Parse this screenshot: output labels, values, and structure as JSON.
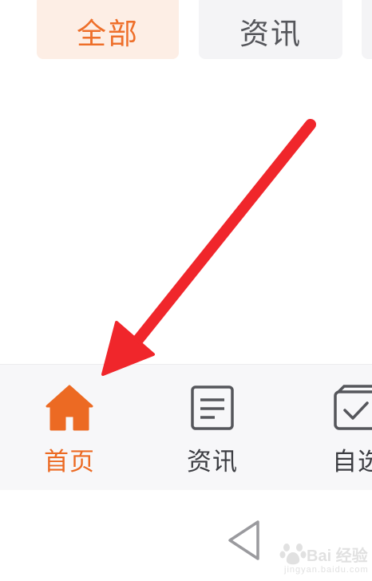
{
  "filter_tabs": {
    "items": [
      {
        "label": "全部",
        "state": "active"
      },
      {
        "label": "资讯",
        "state": "normal"
      }
    ]
  },
  "bottom_nav": {
    "items": [
      {
        "label": "首页",
        "icon": "home-icon",
        "state": "active"
      },
      {
        "label": "资讯",
        "icon": "document-icon",
        "state": "normal"
      },
      {
        "label": "自选",
        "icon": "checkbox-icon",
        "state": "normal"
      }
    ]
  },
  "system_bar": {
    "back_icon": "triangle-back-icon"
  },
  "watermark": {
    "text": "Bai 经验",
    "sub": "jingyan.baidu.com"
  },
  "colors": {
    "accent": "#ec6a23",
    "active_tab_bg": "#fdeee5",
    "tab_bg": "#f4f4f6",
    "nav_bg": "#f7f7f9",
    "annotation_arrow": "#f0262b",
    "icon_gray": "#55565b"
  }
}
